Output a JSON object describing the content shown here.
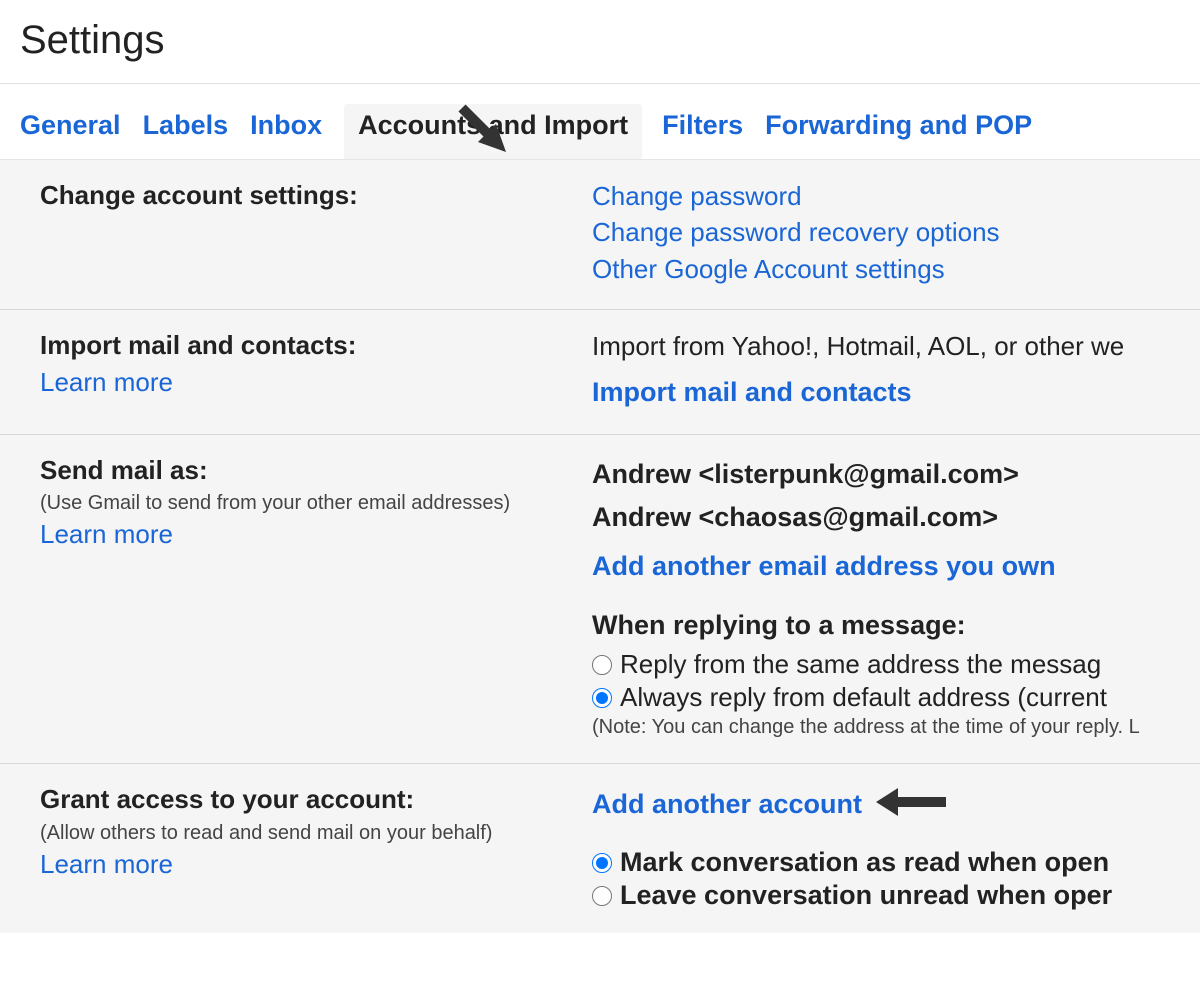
{
  "page": {
    "title": "Settings"
  },
  "tabs": [
    {
      "label": "General"
    },
    {
      "label": "Labels"
    },
    {
      "label": "Inbox"
    },
    {
      "label": "Accounts and Import"
    },
    {
      "label": "Filters"
    },
    {
      "label": "Forwarding and POP"
    }
  ],
  "sections": {
    "change_account": {
      "heading": "Change account settings:",
      "links": {
        "change_password": "Change password",
        "recovery_options": "Change password recovery options",
        "other_settings": "Other Google Account settings"
      }
    },
    "import_mail": {
      "heading": "Import mail and contacts:",
      "learn_more": "Learn more",
      "desc": "Import from Yahoo!, Hotmail, AOL, or other we",
      "action": "Import mail and contacts"
    },
    "send_mail_as": {
      "heading": "Send mail as:",
      "subtext": "(Use Gmail to send from your other email addresses)",
      "learn_more": "Learn more",
      "addr1": "Andrew <listerpunk@gmail.com>",
      "addr2": "Andrew <chaosas@gmail.com>",
      "add_link": "Add another email address you own",
      "reply_heading": "When replying to a message:",
      "reply_opt1": "Reply from the same address the messag",
      "reply_opt2": "Always reply from default address (current",
      "reply_note": "(Note: You can change the address at the time of your reply. L"
    },
    "grant_access": {
      "heading": "Grant access to your account:",
      "subtext": "(Allow others to read and send mail on your behalf)",
      "learn_more": "Learn more",
      "add_link": "Add another account",
      "mark_opt1": "Mark conversation as read when open",
      "mark_opt2": "Leave conversation unread when oper"
    }
  }
}
